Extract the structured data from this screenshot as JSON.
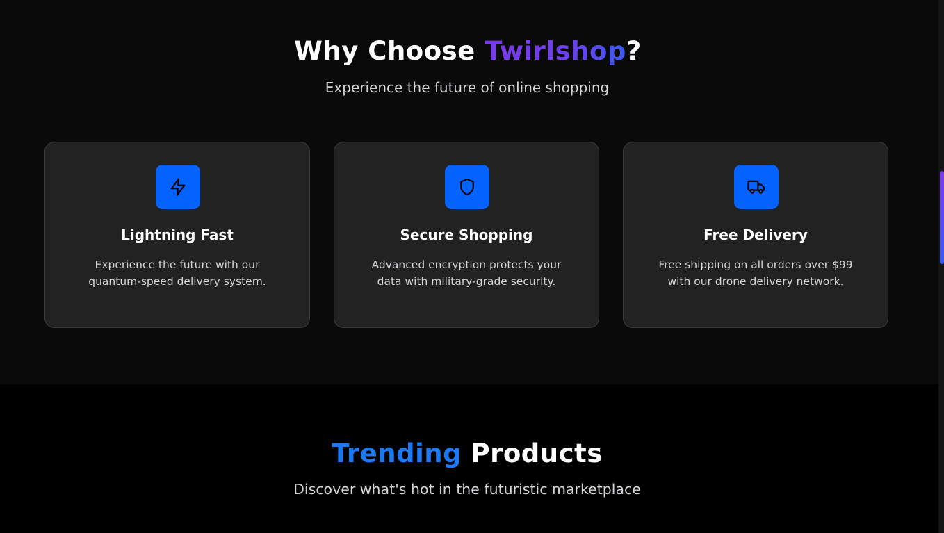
{
  "why": {
    "title_prefix": "Why Choose ",
    "title_brand": "Twirlshop",
    "title_suffix": "?",
    "subtitle": "Experience the future of online shopping",
    "cards": [
      {
        "icon": "lightning-icon",
        "title": "Lightning Fast",
        "description": "Experience the future with our quantum-speed delivery system."
      },
      {
        "icon": "shield-icon",
        "title": "Secure Shopping",
        "description": "Advanced encryption protects your data with military-grade security."
      },
      {
        "icon": "truck-icon",
        "title": "Free Delivery",
        "description": "Free shipping on all orders over $99 with our drone delivery network."
      }
    ]
  },
  "trending": {
    "title_accent": "Trending",
    "title_rest": " Products",
    "subtitle": "Discover what's hot in the futuristic marketplace"
  },
  "colors": {
    "icon_bg": "#0462fd",
    "accent_purple": "#7c3aed",
    "accent_blue": "#1c79f2",
    "card_bg": "#222222"
  }
}
